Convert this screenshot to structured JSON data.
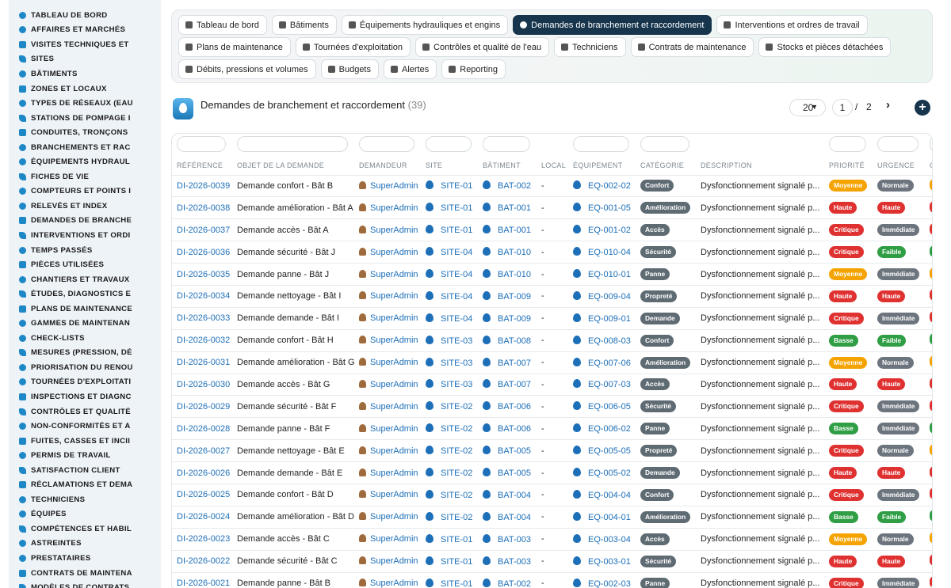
{
  "colors": {
    "link": "#1d6fb8",
    "active_chip": "#17354c",
    "priority": {
      "Moyenne": "#f5a300",
      "Haute": "#e03131",
      "Critique": "#e03131",
      "Basse": "#2f9e44"
    },
    "urgency": {
      "Normale": "#6c757d",
      "Haute": "#e03131",
      "Immédiate": "#6c757d",
      "Faible": "#2f9e44"
    },
    "category": "#5f6b73",
    "extra_column": {
      "Moyenne": "#f5a300",
      "Haute": "#e03131",
      "Critique": "#e03131",
      "Basse": "#2f9e44"
    }
  },
  "sidebar": {
    "items": [
      {
        "label": "TABLEAU DE BORD",
        "icon": "dashboard-icon"
      },
      {
        "label": "AFFAIRES ET MARCHÉS",
        "icon": "target-icon"
      },
      {
        "label": "VISITES TECHNIQUES ET",
        "icon": "calendar-icon"
      },
      {
        "label": "SITES",
        "icon": "location-pin-icon"
      },
      {
        "label": "BÂTIMENTS",
        "icon": "building-icon"
      },
      {
        "label": "ZONES ET LOCAUX",
        "icon": "grid-icon"
      },
      {
        "label": "TYPES DE RÉSEAUX (EAU",
        "icon": "network-icon"
      },
      {
        "label": "STATIONS DE POMPAGE I",
        "icon": "server-icon"
      },
      {
        "label": "CONDUITES, TRONÇONS",
        "icon": "pipe-icon"
      },
      {
        "label": "BRANCHEMENTS ET RAC",
        "icon": "connection-icon"
      },
      {
        "label": "ÉQUIPEMENTS HYDRAUL",
        "icon": "gears-icon"
      },
      {
        "label": "FICHES DE VIE",
        "icon": "file-icon"
      },
      {
        "label": "COMPTEURS ET POINTS I",
        "icon": "gauge-icon"
      },
      {
        "label": "RELEVÉS ET INDEX",
        "icon": "clipboard-icon"
      },
      {
        "label": "DEMANDES DE BRANCHE",
        "icon": "question-icon"
      },
      {
        "label": "INTERVENTIONS ET ORDI",
        "icon": "clipboard-check-icon"
      },
      {
        "label": "TEMPS PASSÉS",
        "icon": "clock-icon"
      },
      {
        "label": "PIÈCES UTILISÉES",
        "icon": "gear-icon"
      },
      {
        "label": "CHANTIERS ET TRAVAUX",
        "icon": "hammer-icon"
      },
      {
        "label": "ÉTUDES, DIAGNOSTICS E",
        "icon": "search-icon"
      },
      {
        "label": "PLANS DE MAINTENANCE",
        "icon": "calendar-check-icon"
      },
      {
        "label": "GAMMES DE MAINTENAN",
        "icon": "list-icon"
      },
      {
        "label": "CHECK-LISTS",
        "icon": "check-square-icon"
      },
      {
        "label": "MESURES (PRESSION, DÉ",
        "icon": "chart-icon"
      },
      {
        "label": "PRIORISATION DU RENOU",
        "icon": "sort-icon"
      },
      {
        "label": "TOURNÉES D'EXPLOITATI",
        "icon": "route-icon"
      },
      {
        "label": "INSPECTIONS ET DIAGNC",
        "icon": "binoculars-icon"
      },
      {
        "label": "CONTRÔLES ET QUALITÉ",
        "icon": "clipboard-check-icon"
      },
      {
        "label": "NON-CONFORMITÉS ET A",
        "icon": "warning-icon"
      },
      {
        "label": "FUITES, CASSES ET INCII",
        "icon": "droplet-icon"
      },
      {
        "label": "PERMIS DE TRAVAIL",
        "icon": "pen-icon"
      },
      {
        "label": "SATISFACTION CLIENT",
        "icon": "smile-icon"
      },
      {
        "label": "RÉCLAMATIONS ET DEMA",
        "icon": "comment-icon"
      },
      {
        "label": "TECHNICIENS",
        "icon": "hard-hat-icon"
      },
      {
        "label": "ÉQUIPES",
        "icon": "users-icon"
      },
      {
        "label": "COMPÉTENCES ET HABIL",
        "icon": "award-icon"
      },
      {
        "label": "ASTREINTES",
        "icon": "phone-icon"
      },
      {
        "label": "PRESTATAIRES",
        "icon": "briefcase-icon"
      },
      {
        "label": "CONTRATS DE MAINTENA",
        "icon": "file-contract-icon"
      },
      {
        "label": "MODÈLES DE CONTRATS",
        "icon": "file-alt-icon"
      }
    ]
  },
  "modules": {
    "rows": [
      [
        {
          "label": "Tableau de bord",
          "icon": "dashboard-icon",
          "active": false
        },
        {
          "label": "Bâtiments",
          "icon": "building-icon",
          "active": false
        },
        {
          "label": "Équipements hydrauliques et engins",
          "icon": "gears-icon",
          "active": false
        },
        {
          "label": "Demandes de branchement et raccordement",
          "icon": "question-icon",
          "active": true
        },
        {
          "label": "Interventions et ordres de travail",
          "icon": "clipboard-check-icon",
          "active": false
        }
      ],
      [
        {
          "label": "Plans de maintenance",
          "icon": "calendar-check-icon",
          "active": false
        },
        {
          "label": "Tournées d'exploitation",
          "icon": "route-icon",
          "active": false
        },
        {
          "label": "Contrôles et qualité de l'eau",
          "icon": "clipboard-check-icon",
          "active": false
        },
        {
          "label": "Techniciens",
          "icon": "hard-hat-icon",
          "active": false
        },
        {
          "label": "Contrats de maintenance",
          "icon": "file-contract-icon",
          "active": false
        },
        {
          "label": "Stocks et pièces détachées",
          "icon": "boxes-icon",
          "active": false
        }
      ],
      [
        {
          "label": "Débits, pressions et volumes",
          "icon": "bolt-icon",
          "active": false
        },
        {
          "label": "Budgets",
          "icon": "money-icon",
          "active": false
        },
        {
          "label": "Alertes",
          "icon": "bell-icon",
          "active": false
        },
        {
          "label": "Reporting",
          "icon": "chart-pie-icon",
          "active": false
        }
      ]
    ]
  },
  "page": {
    "title": "Demandes de branchement et raccordement",
    "count": "(39)",
    "page_size": "20",
    "current_page": "1",
    "page_separator": "/",
    "total_pages": "2",
    "next_glyph": "›",
    "add_glyph": "+"
  },
  "table": {
    "columns": [
      "RÉFÉRENCE",
      "OBJET DE LA DEMANDE",
      "DEMANDEUR",
      "SITE",
      "BÂTIMENT",
      "LOCAL",
      "ÉQUIPEMENT",
      "CATÉGORIE",
      "DESCRIPTION",
      "PRIORITÉ",
      "URGENCE",
      "C"
    ],
    "rows": [
      {
        "ref": "DI-2026-0039",
        "objet": "Demande confort - Bât B",
        "demandeur": "SuperAdmin",
        "site": "SITE-01",
        "batiment": "BAT-002",
        "local": "-",
        "equipement": "EQ-002-02",
        "categorie": "Confort",
        "description": "Dysfonctionnement signalé p...",
        "priorite": "Moyenne",
        "urgence": "Normale",
        "extra": "Moyenne"
      },
      {
        "ref": "DI-2026-0038",
        "objet": "Demande amélioration - Bât A",
        "demandeur": "SuperAdmin",
        "site": "SITE-01",
        "batiment": "BAT-001",
        "local": "-",
        "equipement": "EQ-001-05",
        "categorie": "Amélioration",
        "description": "Dysfonctionnement signalé p...",
        "priorite": "Haute",
        "urgence": "Haute",
        "extra": "Haute"
      },
      {
        "ref": "DI-2026-0037",
        "objet": "Demande accès - Bât A",
        "demandeur": "SuperAdmin",
        "site": "SITE-01",
        "batiment": "BAT-001",
        "local": "-",
        "equipement": "EQ-001-02",
        "categorie": "Accès",
        "description": "Dysfonctionnement signalé p...",
        "priorite": "Critique",
        "urgence": "Immédiate",
        "extra": "Critique"
      },
      {
        "ref": "DI-2026-0036",
        "objet": "Demande sécurité - Bât J",
        "demandeur": "SuperAdmin",
        "site": "SITE-04",
        "batiment": "BAT-010",
        "local": "-",
        "equipement": "EQ-010-04",
        "categorie": "Sécurité",
        "description": "Dysfonctionnement signalé p...",
        "priorite": "Critique",
        "urgence": "Faible",
        "extra": "Basse"
      },
      {
        "ref": "DI-2026-0035",
        "objet": "Demande panne - Bât J",
        "demandeur": "SuperAdmin",
        "site": "SITE-04",
        "batiment": "BAT-010",
        "local": "-",
        "equipement": "EQ-010-01",
        "categorie": "Panne",
        "description": "Dysfonctionnement signalé p...",
        "priorite": "Moyenne",
        "urgence": "Immédiate",
        "extra": "Moyenne"
      },
      {
        "ref": "DI-2026-0034",
        "objet": "Demande nettoyage - Bât I",
        "demandeur": "SuperAdmin",
        "site": "SITE-04",
        "batiment": "BAT-009",
        "local": "-",
        "equipement": "EQ-009-04",
        "categorie": "Propreté",
        "description": "Dysfonctionnement signalé p...",
        "priorite": "Haute",
        "urgence": "Haute",
        "extra": "Haute"
      },
      {
        "ref": "DI-2026-0033",
        "objet": "Demande demande - Bât I",
        "demandeur": "SuperAdmin",
        "site": "SITE-04",
        "batiment": "BAT-009",
        "local": "-",
        "equipement": "EQ-009-01",
        "categorie": "Demande",
        "description": "Dysfonctionnement signalé p...",
        "priorite": "Critique",
        "urgence": "Immédiate",
        "extra": "Critique"
      },
      {
        "ref": "DI-2026-0032",
        "objet": "Demande confort - Bât H",
        "demandeur": "SuperAdmin",
        "site": "SITE-03",
        "batiment": "BAT-008",
        "local": "-",
        "equipement": "EQ-008-03",
        "categorie": "Confort",
        "description": "Dysfonctionnement signalé p...",
        "priorite": "Basse",
        "urgence": "Faible",
        "extra": "Basse"
      },
      {
        "ref": "DI-2026-0031",
        "objet": "Demande amélioration - Bât G",
        "demandeur": "SuperAdmin",
        "site": "SITE-03",
        "batiment": "BAT-007",
        "local": "-",
        "equipement": "EQ-007-06",
        "categorie": "Amélioration",
        "description": "Dysfonctionnement signalé p...",
        "priorite": "Moyenne",
        "urgence": "Normale",
        "extra": "Moyenne"
      },
      {
        "ref": "DI-2026-0030",
        "objet": "Demande accès - Bât G",
        "demandeur": "SuperAdmin",
        "site": "SITE-03",
        "batiment": "BAT-007",
        "local": "-",
        "equipement": "EQ-007-03",
        "categorie": "Accès",
        "description": "Dysfonctionnement signalé p...",
        "priorite": "Haute",
        "urgence": "Haute",
        "extra": "Haute"
      },
      {
        "ref": "DI-2026-0029",
        "objet": "Demande sécurité - Bât F",
        "demandeur": "SuperAdmin",
        "site": "SITE-02",
        "batiment": "BAT-006",
        "local": "-",
        "equipement": "EQ-006-05",
        "categorie": "Sécurité",
        "description": "Dysfonctionnement signalé p...",
        "priorite": "Critique",
        "urgence": "Immédiate",
        "extra": "Critique"
      },
      {
        "ref": "DI-2026-0028",
        "objet": "Demande panne - Bât F",
        "demandeur": "SuperAdmin",
        "site": "SITE-02",
        "batiment": "BAT-006",
        "local": "-",
        "equipement": "EQ-006-02",
        "categorie": "Panne",
        "description": "Dysfonctionnement signalé p...",
        "priorite": "Basse",
        "urgence": "Immédiate",
        "extra": "Basse"
      },
      {
        "ref": "DI-2026-0027",
        "objet": "Demande nettoyage - Bât E",
        "demandeur": "SuperAdmin",
        "site": "SITE-02",
        "batiment": "BAT-005",
        "local": "-",
        "equipement": "EQ-005-05",
        "categorie": "Propreté",
        "description": "Dysfonctionnement signalé p...",
        "priorite": "Critique",
        "urgence": "Normale",
        "extra": "Moyenne"
      },
      {
        "ref": "DI-2026-0026",
        "objet": "Demande demande - Bât E",
        "demandeur": "SuperAdmin",
        "site": "SITE-02",
        "batiment": "BAT-005",
        "local": "-",
        "equipement": "EQ-005-02",
        "categorie": "Demande",
        "description": "Dysfonctionnement signalé p...",
        "priorite": "Haute",
        "urgence": "Haute",
        "extra": "Haute"
      },
      {
        "ref": "DI-2026-0025",
        "objet": "Demande confort - Bât D",
        "demandeur": "SuperAdmin",
        "site": "SITE-02",
        "batiment": "BAT-004",
        "local": "-",
        "equipement": "EQ-004-04",
        "categorie": "Confort",
        "description": "Dysfonctionnement signalé p...",
        "priorite": "Critique",
        "urgence": "Immédiate",
        "extra": "Critique"
      },
      {
        "ref": "DI-2026-0024",
        "objet": "Demande amélioration - Bât D",
        "demandeur": "SuperAdmin",
        "site": "SITE-02",
        "batiment": "BAT-004",
        "local": "-",
        "equipement": "EQ-004-01",
        "categorie": "Amélioration",
        "description": "Dysfonctionnement signalé p...",
        "priorite": "Basse",
        "urgence": "Faible",
        "extra": "Basse"
      },
      {
        "ref": "DI-2026-0023",
        "objet": "Demande accès - Bât C",
        "demandeur": "SuperAdmin",
        "site": "SITE-01",
        "batiment": "BAT-003",
        "local": "-",
        "equipement": "EQ-003-04",
        "categorie": "Accès",
        "description": "Dysfonctionnement signalé p...",
        "priorite": "Moyenne",
        "urgence": "Normale",
        "extra": "Moyenne"
      },
      {
        "ref": "DI-2026-0022",
        "objet": "Demande sécurité - Bât C",
        "demandeur": "SuperAdmin",
        "site": "SITE-01",
        "batiment": "BAT-003",
        "local": "-",
        "equipement": "EQ-003-01",
        "categorie": "Sécurité",
        "description": "Dysfonctionnement signalé p...",
        "priorite": "Haute",
        "urgence": "Haute",
        "extra": "Haute"
      },
      {
        "ref": "DI-2026-0021",
        "objet": "Demande panne - Bât B",
        "demandeur": "SuperAdmin",
        "site": "SITE-01",
        "batiment": "BAT-002",
        "local": "-",
        "equipement": "EQ-002-03",
        "categorie": "Panne",
        "description": "Dysfonctionnement signalé p...",
        "priorite": "Critique",
        "urgence": "Immédiate",
        "extra": "Critique"
      }
    ]
  }
}
